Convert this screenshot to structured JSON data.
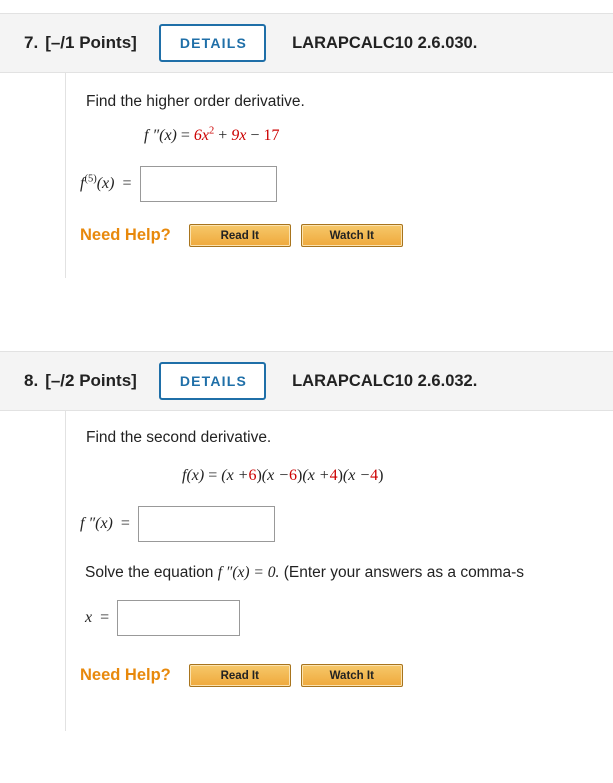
{
  "questions": [
    {
      "number": "7.",
      "points": "[–/1 Points]",
      "details_label": "DETAILS",
      "code": "LARAPCALC10 2.6.030.",
      "prompt": "Find the higher order derivative.",
      "equation": {
        "lhs": "f ″(x)",
        "eq": "=",
        "t1": "6x",
        "t1_exp": "2",
        "op1": "+",
        "t2": "9x",
        "op2": "−",
        "t3": "17"
      },
      "answer_label": "f (5)(x)  =",
      "answer_value": "",
      "help": {
        "label": "Need Help?",
        "read_it": "Read It",
        "watch_it": "Watch It"
      }
    },
    {
      "number": "8.",
      "points": "[–/2 Points]",
      "details_label": "DETAILS",
      "code": "LARAPCALC10 2.6.032.",
      "prompt": "Find the second derivative.",
      "equation": {
        "lhs": "f(x)",
        "eq": "=",
        "f1a": "(x +",
        "f1b": "6",
        "f1c": ")",
        "f2a": "(x −",
        "f2b": "6",
        "f2c": ")",
        "f3a": "(x +",
        "f3b": "4",
        "f3c": ")",
        "f4a": "(x −",
        "f4b": "4",
        "f4c": ")"
      },
      "answer_label": "f ″(x)  =",
      "answer_value": "",
      "solve_text_pre": "Solve the equation ",
      "solve_text_eq": "f ″(x) = 0.",
      "solve_text_post": " (Enter your answers as a comma-s",
      "x_label": "x  =",
      "x_value": "",
      "help": {
        "label": "Need Help?",
        "read_it": "Read It",
        "watch_it": "Watch It"
      }
    }
  ]
}
